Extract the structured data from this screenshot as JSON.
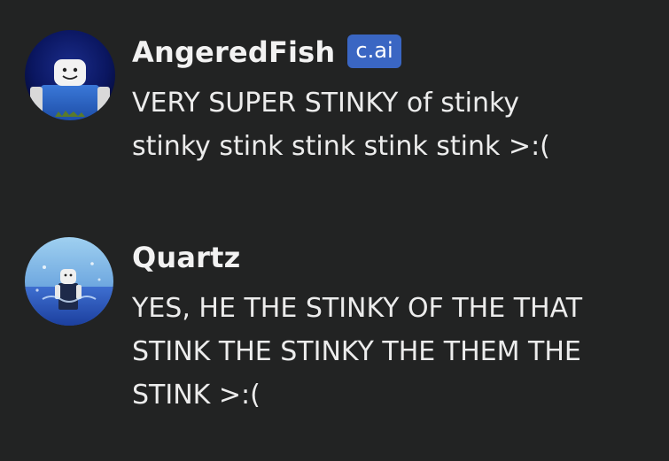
{
  "messages": [
    {
      "author": "AngeredFish",
      "badge": "c.ai",
      "avatar_icon": "roblox-character-avatar",
      "text": "VERY SUPER STINKY of stinky\nstinky stink stink stink stink >:("
    },
    {
      "author": "Quartz",
      "avatar_icon": "roblox-character-ocean-avatar",
      "text": "YES, HE THE STINKY OF THE THAT\nSTINK THE STINKY THE THEM THE\nSTINK >:("
    }
  ],
  "colors": {
    "background": "#222323",
    "text": "#ececec",
    "badge_bg": "#3a66c3"
  }
}
